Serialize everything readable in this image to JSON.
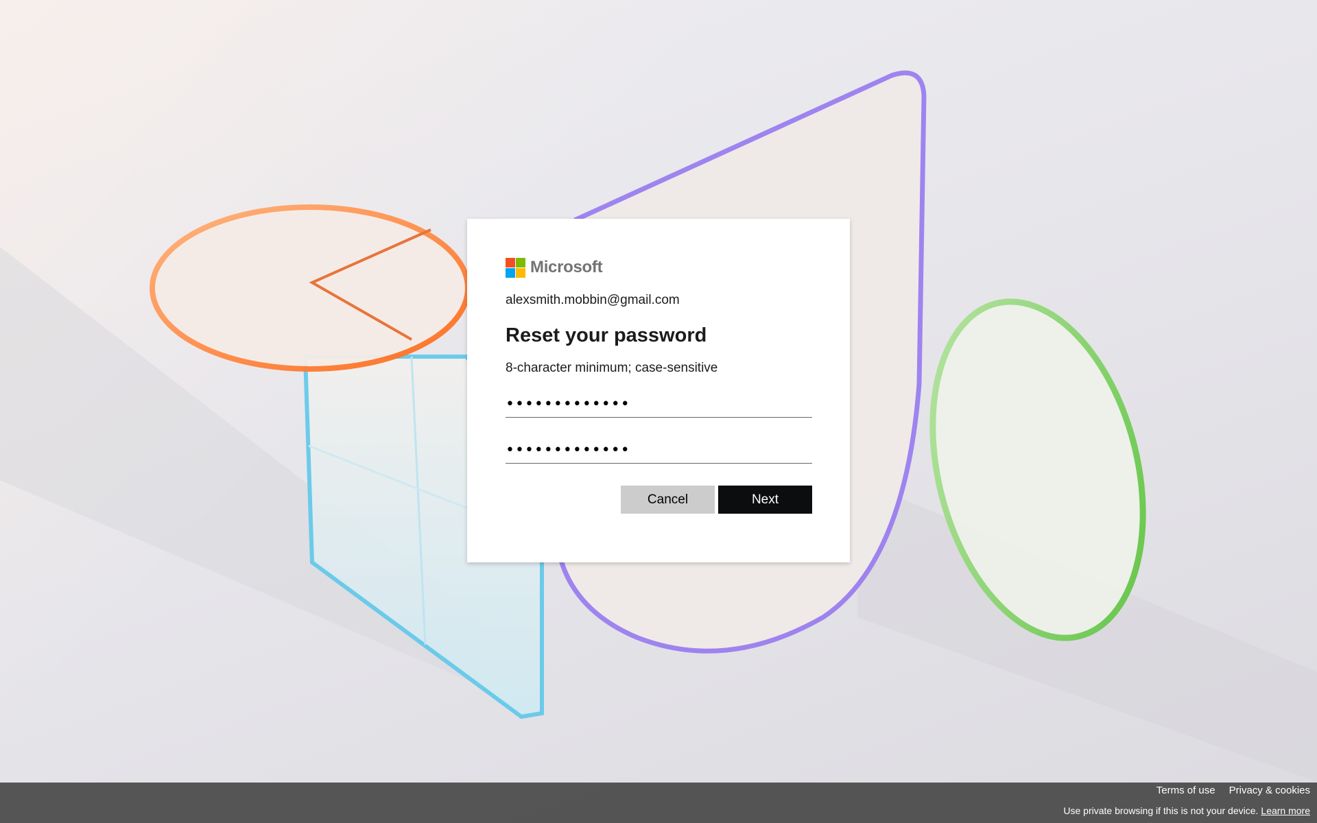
{
  "brand": {
    "name": "Microsoft",
    "logo_colors": [
      "#f25022",
      "#7fba00",
      "#00a4ef",
      "#ffb900"
    ]
  },
  "signin": {
    "identity": "alexsmith.mobbin@gmail.com",
    "title": "Reset your password",
    "hint": "8-character minimum; case-sensitive",
    "new_password_value": "•••••••••••••",
    "confirm_password_value": "•••••••••••••",
    "cancel_label": "Cancel",
    "next_label": "Next"
  },
  "footer": {
    "terms_label": "Terms of use",
    "privacy_label": "Privacy & cookies",
    "private_note": "Use private browsing if this is not your device.",
    "learn_more_label": "Learn more"
  },
  "colors": {
    "next_button": "#0c0d0e",
    "cancel_button": "#cccccc",
    "footer_bar": "#3c3c3c"
  }
}
